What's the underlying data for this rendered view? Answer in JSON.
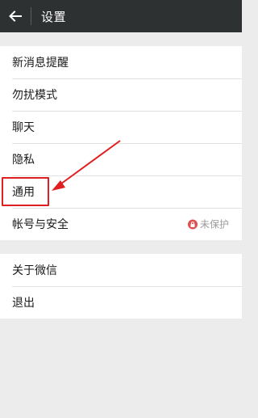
{
  "header": {
    "title": "设置",
    "back_icon": "arrow-left-icon"
  },
  "settings": {
    "group1": [
      {
        "label": "新消息提醒"
      },
      {
        "label": "勿扰模式"
      },
      {
        "label": "聊天"
      },
      {
        "label": "隐私"
      },
      {
        "label": "通用"
      },
      {
        "label": "帐号与安全",
        "status": "未保护",
        "status_icon": "lock-icon"
      }
    ],
    "group2": [
      {
        "label": "关于微信"
      },
      {
        "label": "退出"
      }
    ]
  },
  "annotation": {
    "color": "#e02020",
    "target": "通用"
  }
}
